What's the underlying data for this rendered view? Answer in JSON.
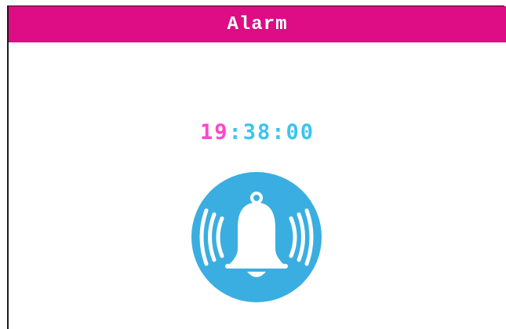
{
  "window": {
    "title": "Alarm"
  },
  "clock": {
    "hours": "19",
    "rest": ":38:00"
  },
  "icon": {
    "name": "ringing-bell-icon"
  },
  "colors": {
    "titlebar": "#de0c85",
    "hours": "#ff44cc",
    "minutes_seconds": "#3bc4f0",
    "icon_background": "#3aaee0",
    "icon_foreground": "#ffffff"
  }
}
